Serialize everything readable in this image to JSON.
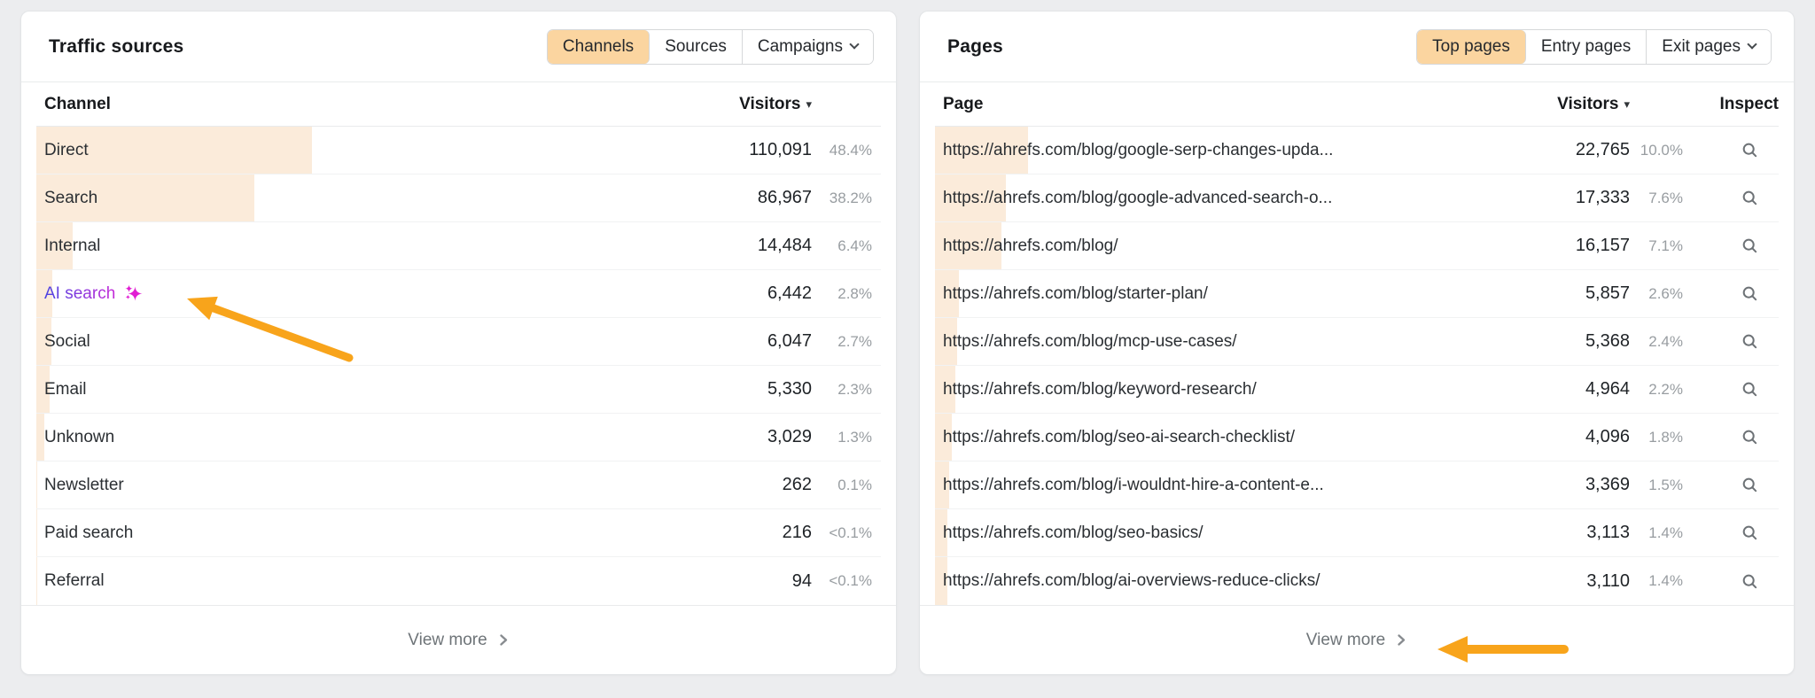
{
  "colors": {
    "page_bg": "#ECEDEF",
    "panel_bg": "#FFFFFF",
    "bar_fill": "#FBEBDA",
    "selected_tab_bg": "#FBD5A0",
    "annotation_arrow": "#F8A41B",
    "ai_gradient_start": "#4B45E2",
    "ai_gradient_end": "#C52BD8",
    "sparkle": "#E11ED3"
  },
  "icons": {
    "sort_caret": "▾"
  },
  "left_panel": {
    "title": "Traffic sources",
    "tabs": [
      {
        "label": "Channels",
        "selected": true,
        "caret": false
      },
      {
        "label": "Sources",
        "selected": false,
        "caret": false
      },
      {
        "label": "Campaigns",
        "selected": false,
        "caret": true
      }
    ],
    "columns": {
      "name": "Channel",
      "visitors": "Visitors"
    },
    "rows": [
      {
        "label": "Direct",
        "visitors": "110,091",
        "pct": "48.4%"
      },
      {
        "label": "Search",
        "visitors": "86,967",
        "pct": "38.2%"
      },
      {
        "label": "Internal",
        "visitors": "14,484",
        "pct": "6.4%"
      },
      {
        "label": "AI search",
        "visitors": "6,442",
        "pct": "2.8%",
        "ai": true
      },
      {
        "label": "Social",
        "visitors": "6,047",
        "pct": "2.7%"
      },
      {
        "label": "Email",
        "visitors": "5,330",
        "pct": "2.3%"
      },
      {
        "label": "Unknown",
        "visitors": "3,029",
        "pct": "1.3%"
      },
      {
        "label": "Newsletter",
        "visitors": "262",
        "pct": "0.1%"
      },
      {
        "label": "Paid search",
        "visitors": "216",
        "pct": "<0.1%"
      },
      {
        "label": "Referral",
        "visitors": "94",
        "pct": "<0.1%"
      }
    ],
    "view_more": "View more"
  },
  "right_panel": {
    "title": "Pages",
    "tabs": [
      {
        "label": "Top pages",
        "selected": true,
        "caret": false
      },
      {
        "label": "Entry pages",
        "selected": false,
        "caret": false
      },
      {
        "label": "Exit pages",
        "selected": false,
        "caret": true
      }
    ],
    "columns": {
      "name": "Page",
      "visitors": "Visitors",
      "inspect": "Inspect"
    },
    "rows": [
      {
        "label": "https://ahrefs.com/blog/google-serp-changes-upda...",
        "visitors": "22,765",
        "pct": "10.0%"
      },
      {
        "label": "https://ahrefs.com/blog/google-advanced-search-o...",
        "visitors": "17,333",
        "pct": "7.6%"
      },
      {
        "label": "https://ahrefs.com/blog/",
        "visitors": "16,157",
        "pct": "7.1%"
      },
      {
        "label": "https://ahrefs.com/blog/starter-plan/",
        "visitors": "5,857",
        "pct": "2.6%"
      },
      {
        "label": "https://ahrefs.com/blog/mcp-use-cases/",
        "visitors": "5,368",
        "pct": "2.4%"
      },
      {
        "label": "https://ahrefs.com/blog/keyword-research/",
        "visitors": "4,964",
        "pct": "2.2%"
      },
      {
        "label": "https://ahrefs.com/blog/seo-ai-search-checklist/",
        "visitors": "4,096",
        "pct": "1.8%"
      },
      {
        "label": "https://ahrefs.com/blog/i-wouldnt-hire-a-content-e...",
        "visitors": "3,369",
        "pct": "1.5%"
      },
      {
        "label": "https://ahrefs.com/blog/seo-basics/",
        "visitors": "3,113",
        "pct": "1.4%"
      },
      {
        "label": "https://ahrefs.com/blog/ai-overviews-reduce-clicks/",
        "visitors": "3,110",
        "pct": "1.4%"
      }
    ],
    "view_more": "View more"
  }
}
